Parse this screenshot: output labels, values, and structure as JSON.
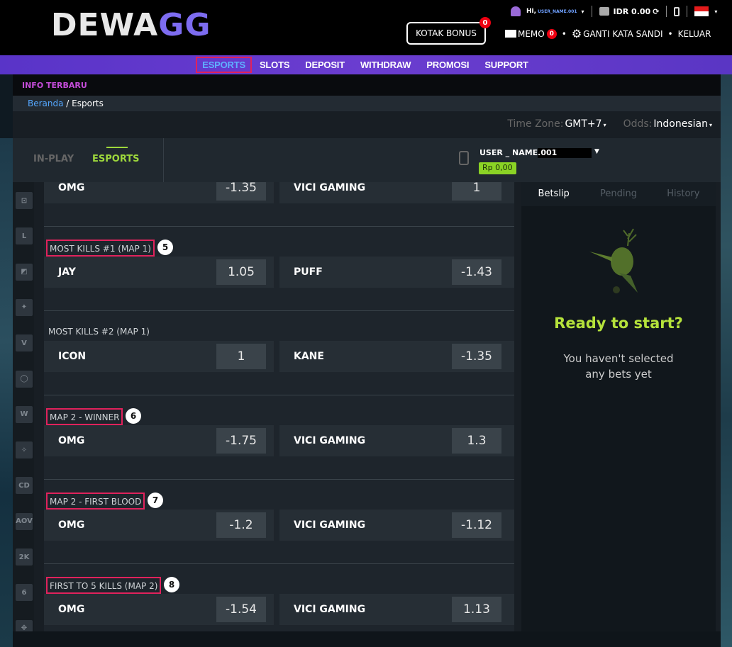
{
  "brand": {
    "logo_main": "DEWA",
    "logo_accent": "GG"
  },
  "topbar": {
    "greeting": "Hi,",
    "username": "USER_NAME.001",
    "currency_balance": "IDR 0.00",
    "bonus_label": "KOTAK BONUS",
    "bonus_count": "0",
    "memo_label": "MEMO",
    "memo_count": "0",
    "change_password": "GANTI KATA SANDI",
    "logout": "KELUAR",
    "dot": "•"
  },
  "nav": {
    "items": [
      "ESPORTS",
      "SLOTS",
      "DEPOSIT",
      "WITHDRAW",
      "PROMOSI",
      "SUPPORT"
    ]
  },
  "info_bar": "INFO TERBARU",
  "breadcrumb": {
    "home": "Beranda",
    "separator": " / ",
    "current": "Esports"
  },
  "filters": {
    "timezone_label": "Time Zone:",
    "timezone_value": "GMT+7",
    "odds_label": "Odds:",
    "odds_value": "Indonesian"
  },
  "tabs": {
    "inplay": "IN-PLAY",
    "esports": "ESPORTS"
  },
  "account": {
    "name": "USER _ NAME.001",
    "balance": "Rp 0,00"
  },
  "sidebar_icons": [
    "pad-icon",
    "lol-icon",
    "dota-icon",
    "csgo-icon",
    "hots-icon",
    "overwatch-icon",
    "warcraft-icon",
    "wolf-icon",
    "cod-icon",
    "aov-icon",
    "nba2k-icon",
    "rainbow6-icon",
    "mtg-icon"
  ],
  "sidebar_icon_labels": [
    "⊡",
    "L",
    "◩",
    "✦",
    "V",
    "◯",
    "W",
    "✧",
    "CD",
    "AOV",
    "2K",
    "6",
    "✥"
  ],
  "markets": [
    {
      "title": "",
      "badge": "",
      "home": "OMG",
      "home_odd": "-1.35",
      "away": "VICI GAMING",
      "away_odd": "1"
    },
    {
      "title": "MOST KILLS #1 (MAP 1)",
      "badge": "5",
      "home": "JAY",
      "home_odd": "1.05",
      "away": "PUFF",
      "away_odd": "-1.43"
    },
    {
      "title": "MOST KILLS #2 (MAP 1)",
      "badge": "",
      "home": "ICON",
      "home_odd": "1",
      "away": "KANE",
      "away_odd": "-1.35"
    },
    {
      "title": "MAP 2 - WINNER",
      "badge": "6",
      "home": "OMG",
      "home_odd": "-1.75",
      "away": "VICI GAMING",
      "away_odd": "1.3"
    },
    {
      "title": "MAP 2 - FIRST BLOOD",
      "badge": "7",
      "home": "OMG",
      "home_odd": "-1.2",
      "away": "VICI GAMING",
      "away_odd": "-1.12"
    },
    {
      "title": "FIRST TO 5 KILLS (MAP 2)",
      "badge": "8",
      "home": "OMG",
      "home_odd": "-1.54",
      "away": "VICI GAMING",
      "away_odd": "1.13"
    }
  ],
  "betslip": {
    "tabs": [
      "Betslip",
      "Pending",
      "History"
    ],
    "title": "Ready to start?",
    "message_line1": "You haven't selected",
    "message_line2": "any bets yet"
  },
  "colors": {
    "accent_green": "#9ed83c",
    "nav_purple": "#6b3dd0",
    "highlight_pink": "#e0225c",
    "link_blue": "#54a7ff"
  }
}
